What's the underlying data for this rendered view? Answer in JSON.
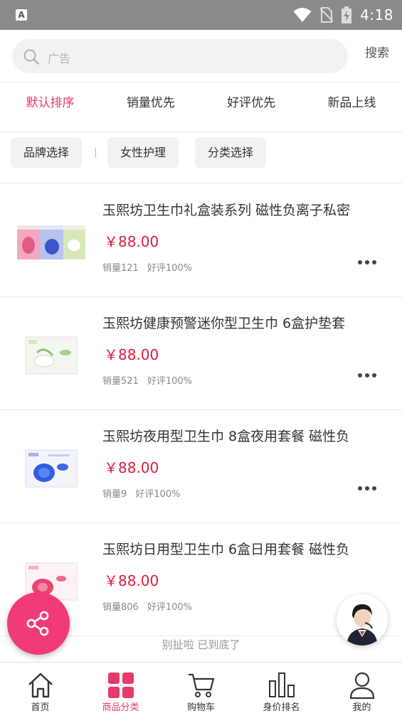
{
  "status_bar": {
    "time": "4:18",
    "app_badge": "A"
  },
  "search": {
    "placeholder": "广告",
    "button_label": "搜索"
  },
  "sort_tabs": [
    {
      "label": "默认排序",
      "active": true
    },
    {
      "label": "销量优先",
      "active": false
    },
    {
      "label": "好评优先",
      "active": false
    },
    {
      "label": "新品上线",
      "active": false
    }
  ],
  "filters": [
    {
      "label": "品牌选择"
    },
    {
      "label": "女性护理"
    },
    {
      "label": "分类选择"
    }
  ],
  "products": [
    {
      "title": "玉熙坊卫生巾礼盒装系列 磁性负离子私密",
      "price": "￥88.00",
      "sales": "销量121",
      "rating": "好评100%"
    },
    {
      "title": "玉熙坊健康预警迷你型卫生巾 6盒护垫套",
      "price": "￥88.00",
      "sales": "销量521",
      "rating": "好评100%"
    },
    {
      "title": "玉熙坊夜用型卫生巾 8盒夜用套餐 磁性负",
      "price": "￥88.00",
      "sales": "销量9",
      "rating": "好评100%"
    },
    {
      "title": "玉熙坊日用型卫生巾 6盒日用套餐 磁性负",
      "price": "￥88.00",
      "sales": "销量806",
      "rating": "好评100%"
    }
  ],
  "end_note": "别扯啦 已到底了",
  "bottom_nav": [
    {
      "label": "首页",
      "icon": "home-icon",
      "active": false
    },
    {
      "label": "商品分类",
      "icon": "grid-icon",
      "active": true
    },
    {
      "label": "购物车",
      "icon": "cart-icon",
      "active": false
    },
    {
      "label": "身价排名",
      "icon": "ranking-icon",
      "active": false
    },
    {
      "label": "我的",
      "icon": "user-icon",
      "active": false
    }
  ],
  "colors": {
    "accent": "#e8396b",
    "price": "#d81e3c",
    "fab": "#f03a7a",
    "status_bar": "#8a8a8a"
  }
}
